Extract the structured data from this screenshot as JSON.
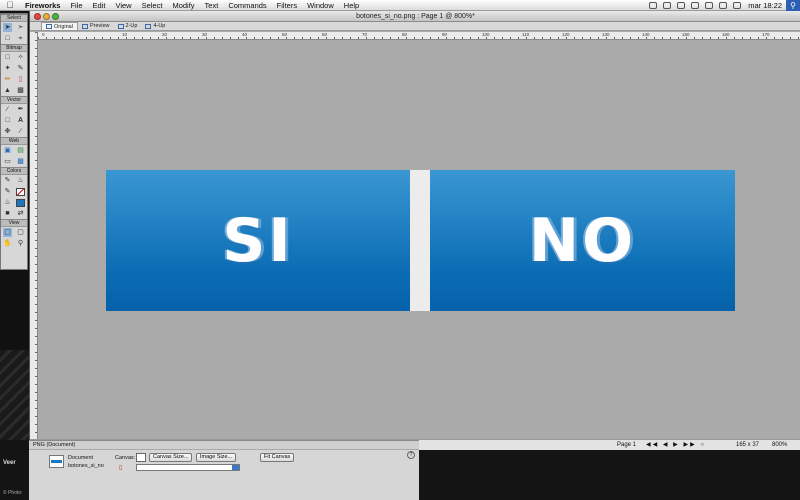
{
  "menubar": {
    "apple_icon": "apple-icon",
    "items": [
      "Fireworks",
      "File",
      "Edit",
      "View",
      "Select",
      "Modify",
      "Text",
      "Commands",
      "Filters",
      "Window",
      "Help"
    ],
    "clock": "mar 18:22",
    "spotlight_icon": "search-icon"
  },
  "window": {
    "title": "botones_si_no.png : Page 1 @ 800%*"
  },
  "view_tabs": [
    "Original",
    "Preview",
    "2-Up",
    "4-Up"
  ],
  "ruler": {
    "labels": [
      "0",
      "10",
      "20",
      "30",
      "40",
      "50",
      "60",
      "70",
      "80",
      "90",
      "100",
      "110",
      "120",
      "130",
      "140",
      "150",
      "160",
      "170"
    ]
  },
  "canvas": {
    "button_left_label": "SI",
    "button_right_label": "NO",
    "button_color_top": "#3a97d2",
    "button_color_bottom": "#0562aa",
    "canvas_bg": "#aaaaaa"
  },
  "tools": {
    "sections": [
      "Select",
      "Bitmap",
      "Vector",
      "Web",
      "Colors",
      "View"
    ]
  },
  "statusbar": {
    "page": "Page 1",
    "dimensions": "165 x 37",
    "zoom": "800%"
  },
  "properties": {
    "header": "PNG (Document)",
    "doc_type": "Document",
    "doc_name": "botones_si_no",
    "canvas_label": "Canvas:",
    "canvas_size_label": "Canvas Size...",
    "image_size_label": "Image Size...",
    "fit_canvas_label": "Fit Canvas"
  },
  "desktop": {
    "photo_credit": "© Photo: ",
    "logo": "Veer"
  }
}
